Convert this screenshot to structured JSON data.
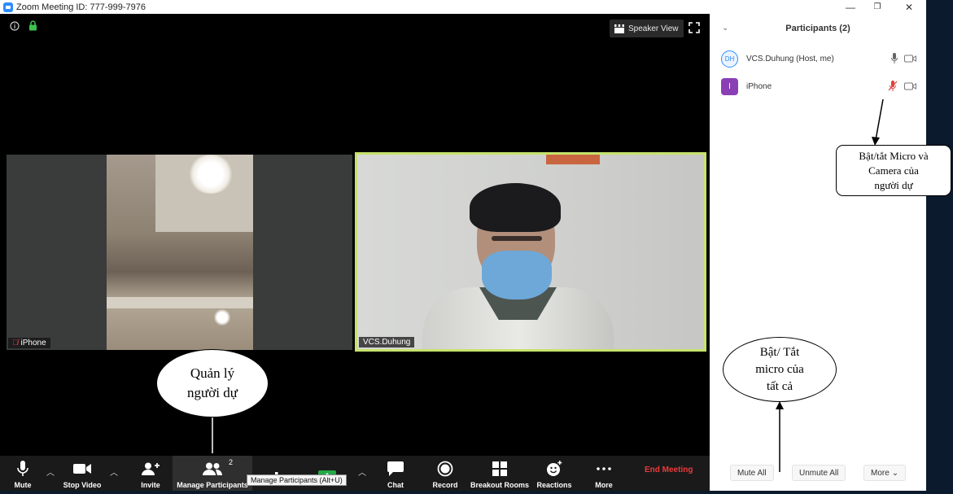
{
  "window": {
    "title": "Zoom Meeting ID: 777-999-7976",
    "minimize": "—",
    "restore": "❐",
    "close": "✕"
  },
  "video": {
    "speaker_view_label": "Speaker View",
    "tiles": [
      {
        "name": "iPhone",
        "muted": true
      },
      {
        "name": "VCS.Duhung",
        "muted": false,
        "active": true
      }
    ]
  },
  "toolbar": {
    "mute": "Mute",
    "stop_video": "Stop Video",
    "invite": "Invite",
    "manage_participants": "Manage Participants",
    "participant_count": "2",
    "chat": "Chat",
    "record": "Record",
    "breakout_rooms": "Breakout Rooms",
    "reactions": "Reactions",
    "more": "More",
    "end_meeting": "End Meeting",
    "tooltip": "Manage Participants (Alt+U)"
  },
  "participants_panel": {
    "title": "Participants (2)",
    "participants": [
      {
        "initials": "DH",
        "name": "VCS.Duhung (Host, me)",
        "mic": "on",
        "video": "off"
      },
      {
        "initials": "I",
        "name": "iPhone",
        "mic": "muted",
        "video": "off"
      }
    ],
    "mute_all": "Mute All",
    "unmute_all": "Unmute All",
    "more": "More"
  },
  "annotations": {
    "manage": [
      "Quản lý",
      "người dự"
    ],
    "toggle_mic_camera": [
      "Bật/tắt Micro và",
      "Camera của",
      "người dự"
    ],
    "toggle_all": [
      "Bật/ Tắt",
      "micro của",
      "tất cả"
    ]
  },
  "colors": {
    "accent": "#2d8cff",
    "active_speaker_border": "#c5e36b",
    "end_meeting": "#ea3b3b",
    "share_green": "#23a846",
    "iphone_avatar": "#8a3fb5"
  }
}
